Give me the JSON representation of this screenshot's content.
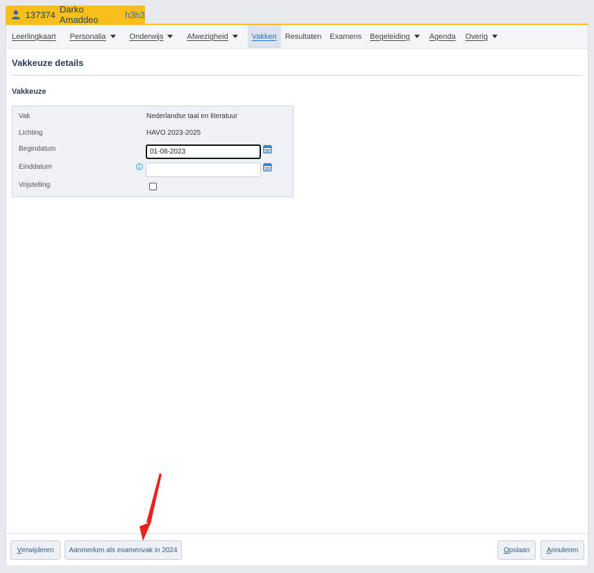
{
  "student": {
    "id": "137374",
    "name": "Darko Amaddeo",
    "klas": "h3h3"
  },
  "nav": {
    "items": [
      {
        "label": "Leerlingkaart",
        "dropdown": false
      },
      {
        "label": "Personalia",
        "dropdown": true
      },
      {
        "label": "Onderwijs",
        "dropdown": true
      },
      {
        "label": "Afwezigheid",
        "dropdown": true
      },
      {
        "label": "Vakken",
        "dropdown": false,
        "active": true
      },
      {
        "label": "Resultaten",
        "dropdown": false
      },
      {
        "label": "Examens",
        "dropdown": false
      },
      {
        "label": "Begeleiding",
        "dropdown": true
      },
      {
        "label": "Agenda",
        "dropdown": false
      },
      {
        "label": "Overig",
        "dropdown": true
      }
    ]
  },
  "page": {
    "title": "Vakkeuze details",
    "section": "Vakkeuze"
  },
  "form": {
    "vak": {
      "label": "Vak",
      "value": "Nederlandse taal en literatuur"
    },
    "lichting": {
      "label": "Lichting",
      "value": "HAVO 2023-2025"
    },
    "begindatum": {
      "label": "Begindatum",
      "value": "01-08-2023"
    },
    "einddatum": {
      "label": "Einddatum",
      "value": ""
    },
    "vrijstelling": {
      "label": "Vrijstelling",
      "checked": false
    }
  },
  "footer": {
    "delete_first": "V",
    "delete_rest": "erwijderen",
    "mark_exam": "Aanmerken als examenvak in 2024",
    "save_first": "O",
    "save_rest": "pslaan",
    "cancel_first": "A",
    "cancel_rest": "nnuleren"
  },
  "colors": {
    "accent": "#f6bf1c",
    "link": "#2f6fb3",
    "annotation_arrow": "#e8231a"
  }
}
